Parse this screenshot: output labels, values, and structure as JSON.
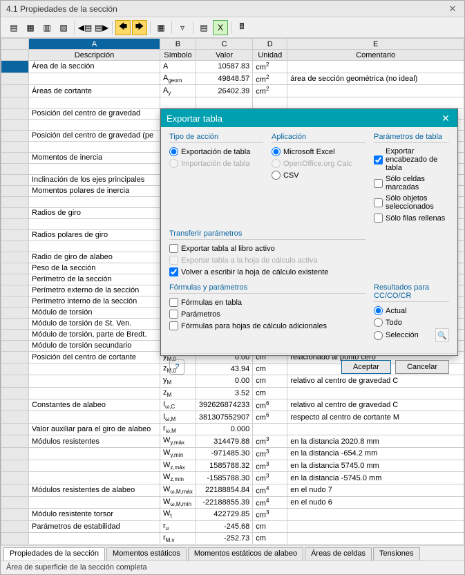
{
  "window": {
    "title": "4.1 Propiedades de la sección"
  },
  "columns": {
    "A": "A",
    "B": "B",
    "C": "C",
    "D": "D",
    "E": "E"
  },
  "headers": {
    "desc": "Descripción",
    "sym": "Símbolo",
    "val": "Valor",
    "unit": "Unidad",
    "com": "Comentario"
  },
  "rows": [
    {
      "d": "Área de la sección",
      "s": "A",
      "v": "10587.83",
      "u": "cm<sup>2</sup>",
      "c": ""
    },
    {
      "d": "",
      "s": "A<sub>geom</sub>",
      "v": "49848.57",
      "u": "cm<sup>2</sup>",
      "c": "área de sección geométrica (no ideal)"
    },
    {
      "d": "Áreas de cortante",
      "s": "A<sub>y</sub>",
      "v": "26402.39",
      "u": "cm<sup>2</sup>",
      "c": ""
    },
    {
      "d": "",
      "s": "",
      "v": "",
      "u": "",
      "c": ""
    },
    {
      "d": "Posición del centro de gravedad",
      "s": "",
      "v": "",
      "u": "",
      "c": ""
    },
    {
      "d": "",
      "s": "",
      "v": "",
      "u": "",
      "c": ""
    },
    {
      "d": "Posición del centro de gravedad (pe",
      "s": "",
      "v": "",
      "u": "",
      "c": ""
    },
    {
      "d": "",
      "s": "",
      "v": "",
      "u": "",
      "c": ""
    },
    {
      "d": "Momentos de inercia",
      "s": "",
      "v": "",
      "u": "",
      "c": ""
    },
    {
      "d": "",
      "s": "",
      "v": "",
      "u": "",
      "c": ""
    },
    {
      "d": "Inclinación de los ejes principales",
      "s": "",
      "v": "",
      "u": "",
      "c": ""
    },
    {
      "d": "Momentos polares de inercia",
      "s": "",
      "v": "",
      "u": "",
      "c": ""
    },
    {
      "d": "",
      "s": "",
      "v": "",
      "u": "",
      "c": ""
    },
    {
      "d": "Radios de giro",
      "s": "",
      "v": "",
      "u": "",
      "c": ""
    },
    {
      "d": "",
      "s": "",
      "v": "",
      "u": "",
      "c": ""
    },
    {
      "d": "Radios polares de giro",
      "s": "",
      "v": "",
      "u": "",
      "c": ""
    },
    {
      "d": "",
      "s": "",
      "v": "",
      "u": "",
      "c": ""
    },
    {
      "d": "Radio de giro de alabeo",
      "s": "",
      "v": "",
      "u": "",
      "c": ""
    },
    {
      "d": "Peso de la sección",
      "s": "",
      "v": "",
      "u": "",
      "c": ""
    },
    {
      "d": "Perímetro de la sección",
      "s": "",
      "v": "",
      "u": "",
      "c": ""
    },
    {
      "d": "Perímetro externo de la sección",
      "s": "",
      "v": "",
      "u": "",
      "c": ""
    },
    {
      "d": "Perímetro interno de la sección",
      "s": "",
      "v": "",
      "u": "",
      "c": ""
    },
    {
      "d": "Módulo de torsión",
      "s": "",
      "v": "",
      "u": "",
      "c": ""
    },
    {
      "d": "Módulo de torsión de St. Ven.",
      "s": "",
      "v": "",
      "u": "",
      "c": ""
    },
    {
      "d": "Módulo de torsión, parte de Bredt.",
      "s": "",
      "v": "",
      "u": "",
      "c": ""
    },
    {
      "d": "Módulo de torsión secundario",
      "s": "",
      "v": "",
      "u": "",
      "c": ""
    },
    {
      "d": "Posición del centro de cortante",
      "s": "y<sub>M,0</sub>",
      "v": "0.00",
      "u": "cm",
      "c": "relacionado al punto cero"
    },
    {
      "d": "",
      "s": "z<sub>M,0</sub>",
      "v": "43.94",
      "u": "cm",
      "c": ""
    },
    {
      "d": "",
      "s": "y<sub>M</sub>",
      "v": "0.00",
      "u": "cm",
      "c": "relativo al centro de gravedad C"
    },
    {
      "d": "",
      "s": "z<sub>M</sub>",
      "v": "3.52",
      "u": "cm",
      "c": ""
    },
    {
      "d": "Constantes de alabeo",
      "s": "I<sub>ω,C</sub>",
      "v": "392626874233",
      "u": "cm<sup>6</sup>",
      "c": "relativo al centro de gravedad C"
    },
    {
      "d": "",
      "s": "I<sub>ω,M</sub>",
      "v": "381307552907",
      "u": "cm<sup>6</sup>",
      "c": "respecto al centro de cortante M"
    },
    {
      "d": "Valor auxiliar para el giro de alabeo",
      "s": "r<sub>ω,M</sub>",
      "v": "0.000",
      "u": "",
      "c": ""
    },
    {
      "d": "Módulos resistentes",
      "s": "W<sub>y,máx</sub>",
      "v": "314479.88",
      "u": "cm<sup>3</sup>",
      "c": "en la distancia 2020.8 mm"
    },
    {
      "d": "",
      "s": "W<sub>y,mín</sub>",
      "v": "-971485.30",
      "u": "cm<sup>3</sup>",
      "c": "en la distancia -654.2 mm"
    },
    {
      "d": "",
      "s": "W<sub>z,máx</sub>",
      "v": "1585788.32",
      "u": "cm<sup>3</sup>",
      "c": "en la distancia 5745.0 mm"
    },
    {
      "d": "",
      "s": "W<sub>z,mín</sub>",
      "v": "-1585788.30",
      "u": "cm<sup>3</sup>",
      "c": "en la distancia -5745.0 mm"
    },
    {
      "d": "Módulos resistentes de alabeo",
      "s": "W<sub>ω,M,máx</sub>",
      "v": "22188854.84",
      "u": "cm<sup>4</sup>",
      "c": "en el nudo 7"
    },
    {
      "d": "",
      "s": "W<sub>ω,M,mín</sub>",
      "v": "-22188855.39",
      "u": "cm<sup>4</sup>",
      "c": "en el nudo 6"
    },
    {
      "d": "Módulo resistente torsor",
      "s": "W<sub>t</sub>",
      "v": "422729.85",
      "u": "cm<sup>3</sup>",
      "c": ""
    },
    {
      "d": "Parámetros de estabilidad",
      "s": "r<sub>u</sub>",
      "v": "-245.68",
      "u": "cm",
      "c": ""
    },
    {
      "d": "",
      "s": "r<sub>M,v</sub>",
      "v": "-252.73",
      "u": "cm",
      "c": ""
    }
  ],
  "tabs": [
    {
      "label": "Propiedades de la sección",
      "active": true
    },
    {
      "label": "Momentos estáticos",
      "active": false
    },
    {
      "label": "Momentos estáticos de alabeo",
      "active": false
    },
    {
      "label": "Áreas de celdas",
      "active": false
    },
    {
      "label": "Tensiones",
      "active": false
    }
  ],
  "status": "Área de superficie de la sección completa",
  "dialog": {
    "title": "Exportar tabla",
    "groups": {
      "action": "Tipo de acción",
      "app": "Aplicación",
      "params": "Parámetros de tabla",
      "transfer": "Transferir parámetros",
      "formulas": "Fórmulas y parámetros",
      "results": "Resultados para CC/CO/CR"
    },
    "options": {
      "export_table": "Exportación de tabla",
      "import_table": "Importación de tabla",
      "excel": "Microsoft Excel",
      "ooo": "OpenOffice.org Calc",
      "csv": "CSV",
      "header": "Exportar encabezado de tabla",
      "marked": "Sólo celdas marcadas",
      "selected": "Sólo objetos seleccionados",
      "filled": "Sólo filas rellenas",
      "active_book": "Exportar tabla al libro activo",
      "active_sheet": "Exportar tabla a la hoja de cálculo activa",
      "rewrite": "Volver a escribir la hoja de cálculo existente",
      "formulas_tab": "Fórmulas en tabla",
      "parameters": "Parámetros",
      "extra_sheets": "Fórmulas para hojas de cálculo adicionales",
      "actual": "Actual",
      "all": "Todo",
      "selection": "Selección"
    },
    "buttons": {
      "ok": "Aceptar",
      "cancel": "Cancelar"
    }
  }
}
